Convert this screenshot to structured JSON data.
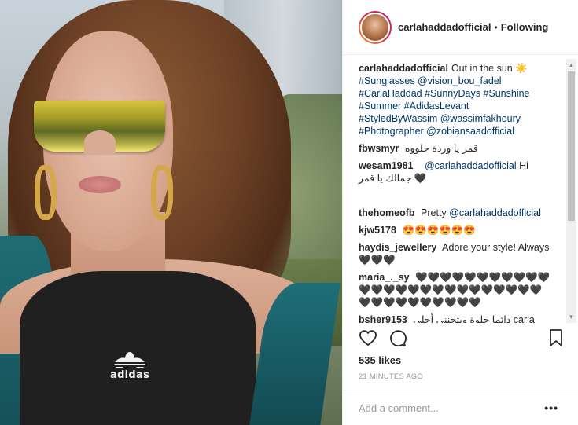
{
  "post": {
    "username": "carlahaddadofficial",
    "separator": "•",
    "follow_status": "Following",
    "caption": {
      "username": "carlahaddadofficial",
      "text": "Out in the sun ☀️",
      "line2": "#Sunglasses @vision_bou_fadel",
      "line3": "#CarlaHaddad #SunnyDays #Sunshine",
      "line4": "#Summer #AdidasLevant",
      "line5": "#StyledByWassim @wassimfakhoury",
      "line6": "#Photographer @zobiansaadofficial"
    },
    "photo_logo_text": "adidas"
  },
  "comments": [
    {
      "user": "fbwsmyr",
      "text": "قمر يا وردة حلووه"
    },
    {
      "user": "wesam1981_",
      "mention": "@carlahaddadofficial",
      "text": "Hi جمالك يا قمر 🖤"
    },
    {
      "user": "thehomeofb",
      "text": "Pretty",
      "mention": "@carlahaddadofficial"
    },
    {
      "user": "kjw5178",
      "text": "😍😍😍😍😍😍"
    },
    {
      "user": "haydis_jewellery",
      "text": "Adore your style! Always 🖤🖤🖤"
    },
    {
      "user": "maria_._sy",
      "text": "🖤🖤🖤🖤🖤🖤🖤🖤🖤🖤🖤🖤🖤🖤🖤🖤🖤🖤🖤🖤🖤🖤🖤🖤🖤🖤🖤🖤🖤🖤🖤🖤🖤🖤🖤🖤"
    },
    {
      "user": "bsher9153",
      "text": "دائما حلوة وبتجنني أحلى carla carla ya"
    }
  ],
  "actions": {
    "like_icon": "heart-icon",
    "comment_icon": "comment-icon",
    "save_icon": "bookmark-icon"
  },
  "likes": "535 likes",
  "timestamp": "21 MINUTES AGO",
  "add_comment": {
    "placeholder": "Add a comment...",
    "more_label": "•••"
  }
}
